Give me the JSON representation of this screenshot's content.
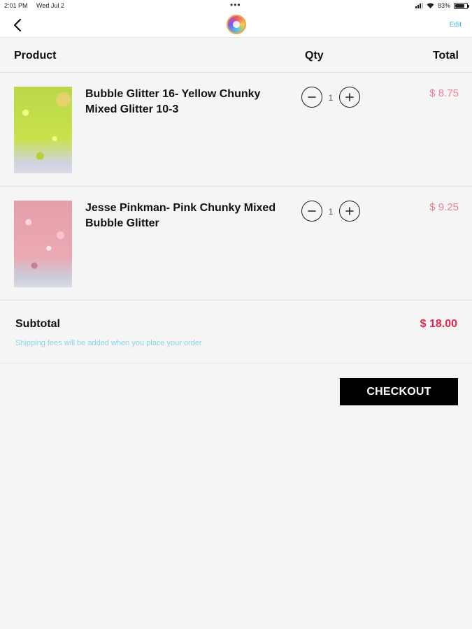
{
  "status_bar": {
    "time": "2:01 PM",
    "date": "Wed Jul 2",
    "battery": "83%",
    "battery_level": 0.83
  },
  "nav": {
    "edit_label": "Edit"
  },
  "table_header": {
    "product": "Product",
    "qty": "Qty",
    "total": "Total"
  },
  "items": [
    {
      "name": "Bubble Glitter 16- Yellow Chunky Mixed Glitter 10-3",
      "qty": "1",
      "price": "$ 8.75"
    },
    {
      "name": "Jesse Pinkman- Pink Chunky Mixed Bubble Glitter",
      "qty": "1",
      "price": "$ 9.25"
    }
  ],
  "summary": {
    "subtotal_label": "Subtotal",
    "subtotal_value": "$ 18.00",
    "shipping_note": "Shipping fees will be added when you place your order"
  },
  "checkout_label": "CHECKOUT",
  "colors": {
    "price": "#ec7f95",
    "subtotal": "#e3254f",
    "note": "#8fd3e6",
    "edit": "#3ab3d8"
  }
}
